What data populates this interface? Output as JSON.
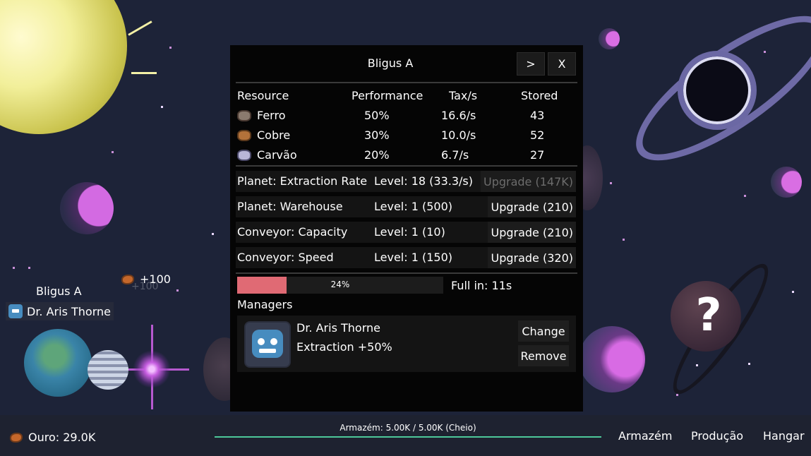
{
  "colors": {
    "progress_fill": "#e06a74",
    "warehouse_bar": "#4dc89a",
    "panel_bg": "#050505",
    "space_bg": "#1d2338"
  },
  "scene": {
    "planet_name": "Bligus A",
    "manager_tag": "Dr. Aris Thorne",
    "gain": "+100",
    "gain_ghost": "+100",
    "mystery_symbol": "?"
  },
  "panel": {
    "title": "Bligus A",
    "next_label": ">",
    "close_label": "X",
    "headers": {
      "resource": "Resource",
      "performance": "Performance",
      "tax": "Tax/s",
      "stored": "Stored"
    },
    "resources": [
      {
        "name": "Ferro",
        "icon": "iron-ore-icon",
        "performance": "50%",
        "tax": "16.6/s",
        "stored": "43"
      },
      {
        "name": "Cobre",
        "icon": "copper-ore-icon",
        "performance": "30%",
        "tax": "10.0/s",
        "stored": "52"
      },
      {
        "name": "Carvão",
        "icon": "coal-ore-icon",
        "performance": "20%",
        "tax": "6.7/s",
        "stored": "27"
      }
    ],
    "upgrades": [
      {
        "name": "Planet: Extraction Rate",
        "level": "Level: 18  (33.3/s)",
        "button": "Upgrade (147K)",
        "enabled": false
      },
      {
        "name": "Planet: Warehouse",
        "level": "Level: 1  (500)",
        "button": "Upgrade (210)",
        "enabled": true
      },
      {
        "name": "Conveyor: Capacity",
        "level": "Level: 1  (10)",
        "button": "Upgrade (210)",
        "enabled": true
      },
      {
        "name": "Conveyor: Speed",
        "level": "Level: 1  (150)",
        "button": "Upgrade (320)",
        "enabled": true
      }
    ],
    "progress": {
      "value": 0.24,
      "label": "24%"
    },
    "full_in": "Full in: 11s",
    "managers_heading": "Managers",
    "manager": {
      "name": "Dr. Aris Thorne",
      "bonus": "Extraction +50%",
      "change_label": "Change",
      "remove_label": "Remove"
    }
  },
  "bottom": {
    "gold": "Ouro: 29.0K",
    "warehouse": "Armazém: 5.00K / 5.00K (Cheio)",
    "nav": [
      "Armazém",
      "Produção",
      "Hangar"
    ]
  }
}
